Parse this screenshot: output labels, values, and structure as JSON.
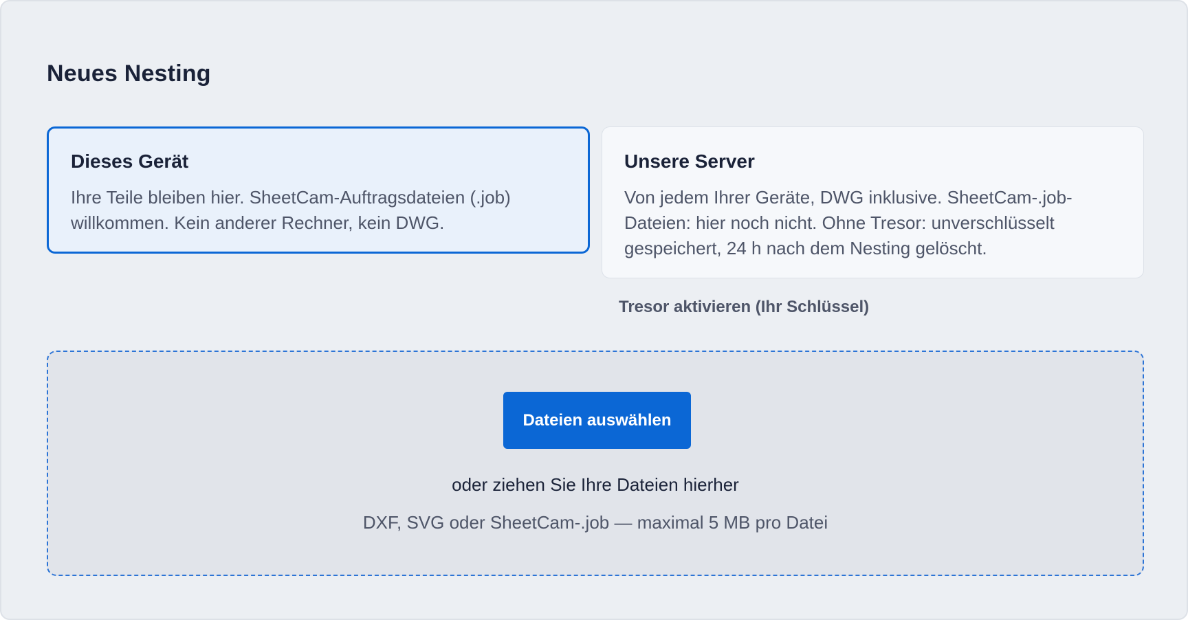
{
  "page": {
    "title": "Neues Nesting"
  },
  "options": [
    {
      "title": "Dieses Gerät",
      "description": "Ihre Teile bleiben hier. SheetCam-Auftragsdateien (.job) willkommen. Kein anderer Rechner, kein DWG.",
      "selected": true
    },
    {
      "title": "Unsere Server",
      "description": "Von jedem Ihrer Geräte, DWG inklusive. SheetCam-.job-Dateien: hier noch nicht. Ohne Tresor: unverschlüsselt gespeichert, 24 h nach dem Nesting gelöscht.",
      "selected": false
    }
  ],
  "vault": {
    "link_label": "Tresor aktivieren (Ihr Schlüssel)"
  },
  "upload": {
    "button_label": "Dateien auswählen",
    "drop_text": "oder ziehen Sie Ihre Dateien hierher",
    "hint": "DXF, SVG oder SheetCam-.job — maximal 5 MB pro Datei"
  },
  "colors": {
    "accent": "#0b67d5",
    "panel_background": "#eceff3",
    "selected_background": "#e9f1fb",
    "dropzone_background": "#e1e4ea",
    "text_primary": "#1a2238",
    "text_secondary": "#4e5568"
  }
}
